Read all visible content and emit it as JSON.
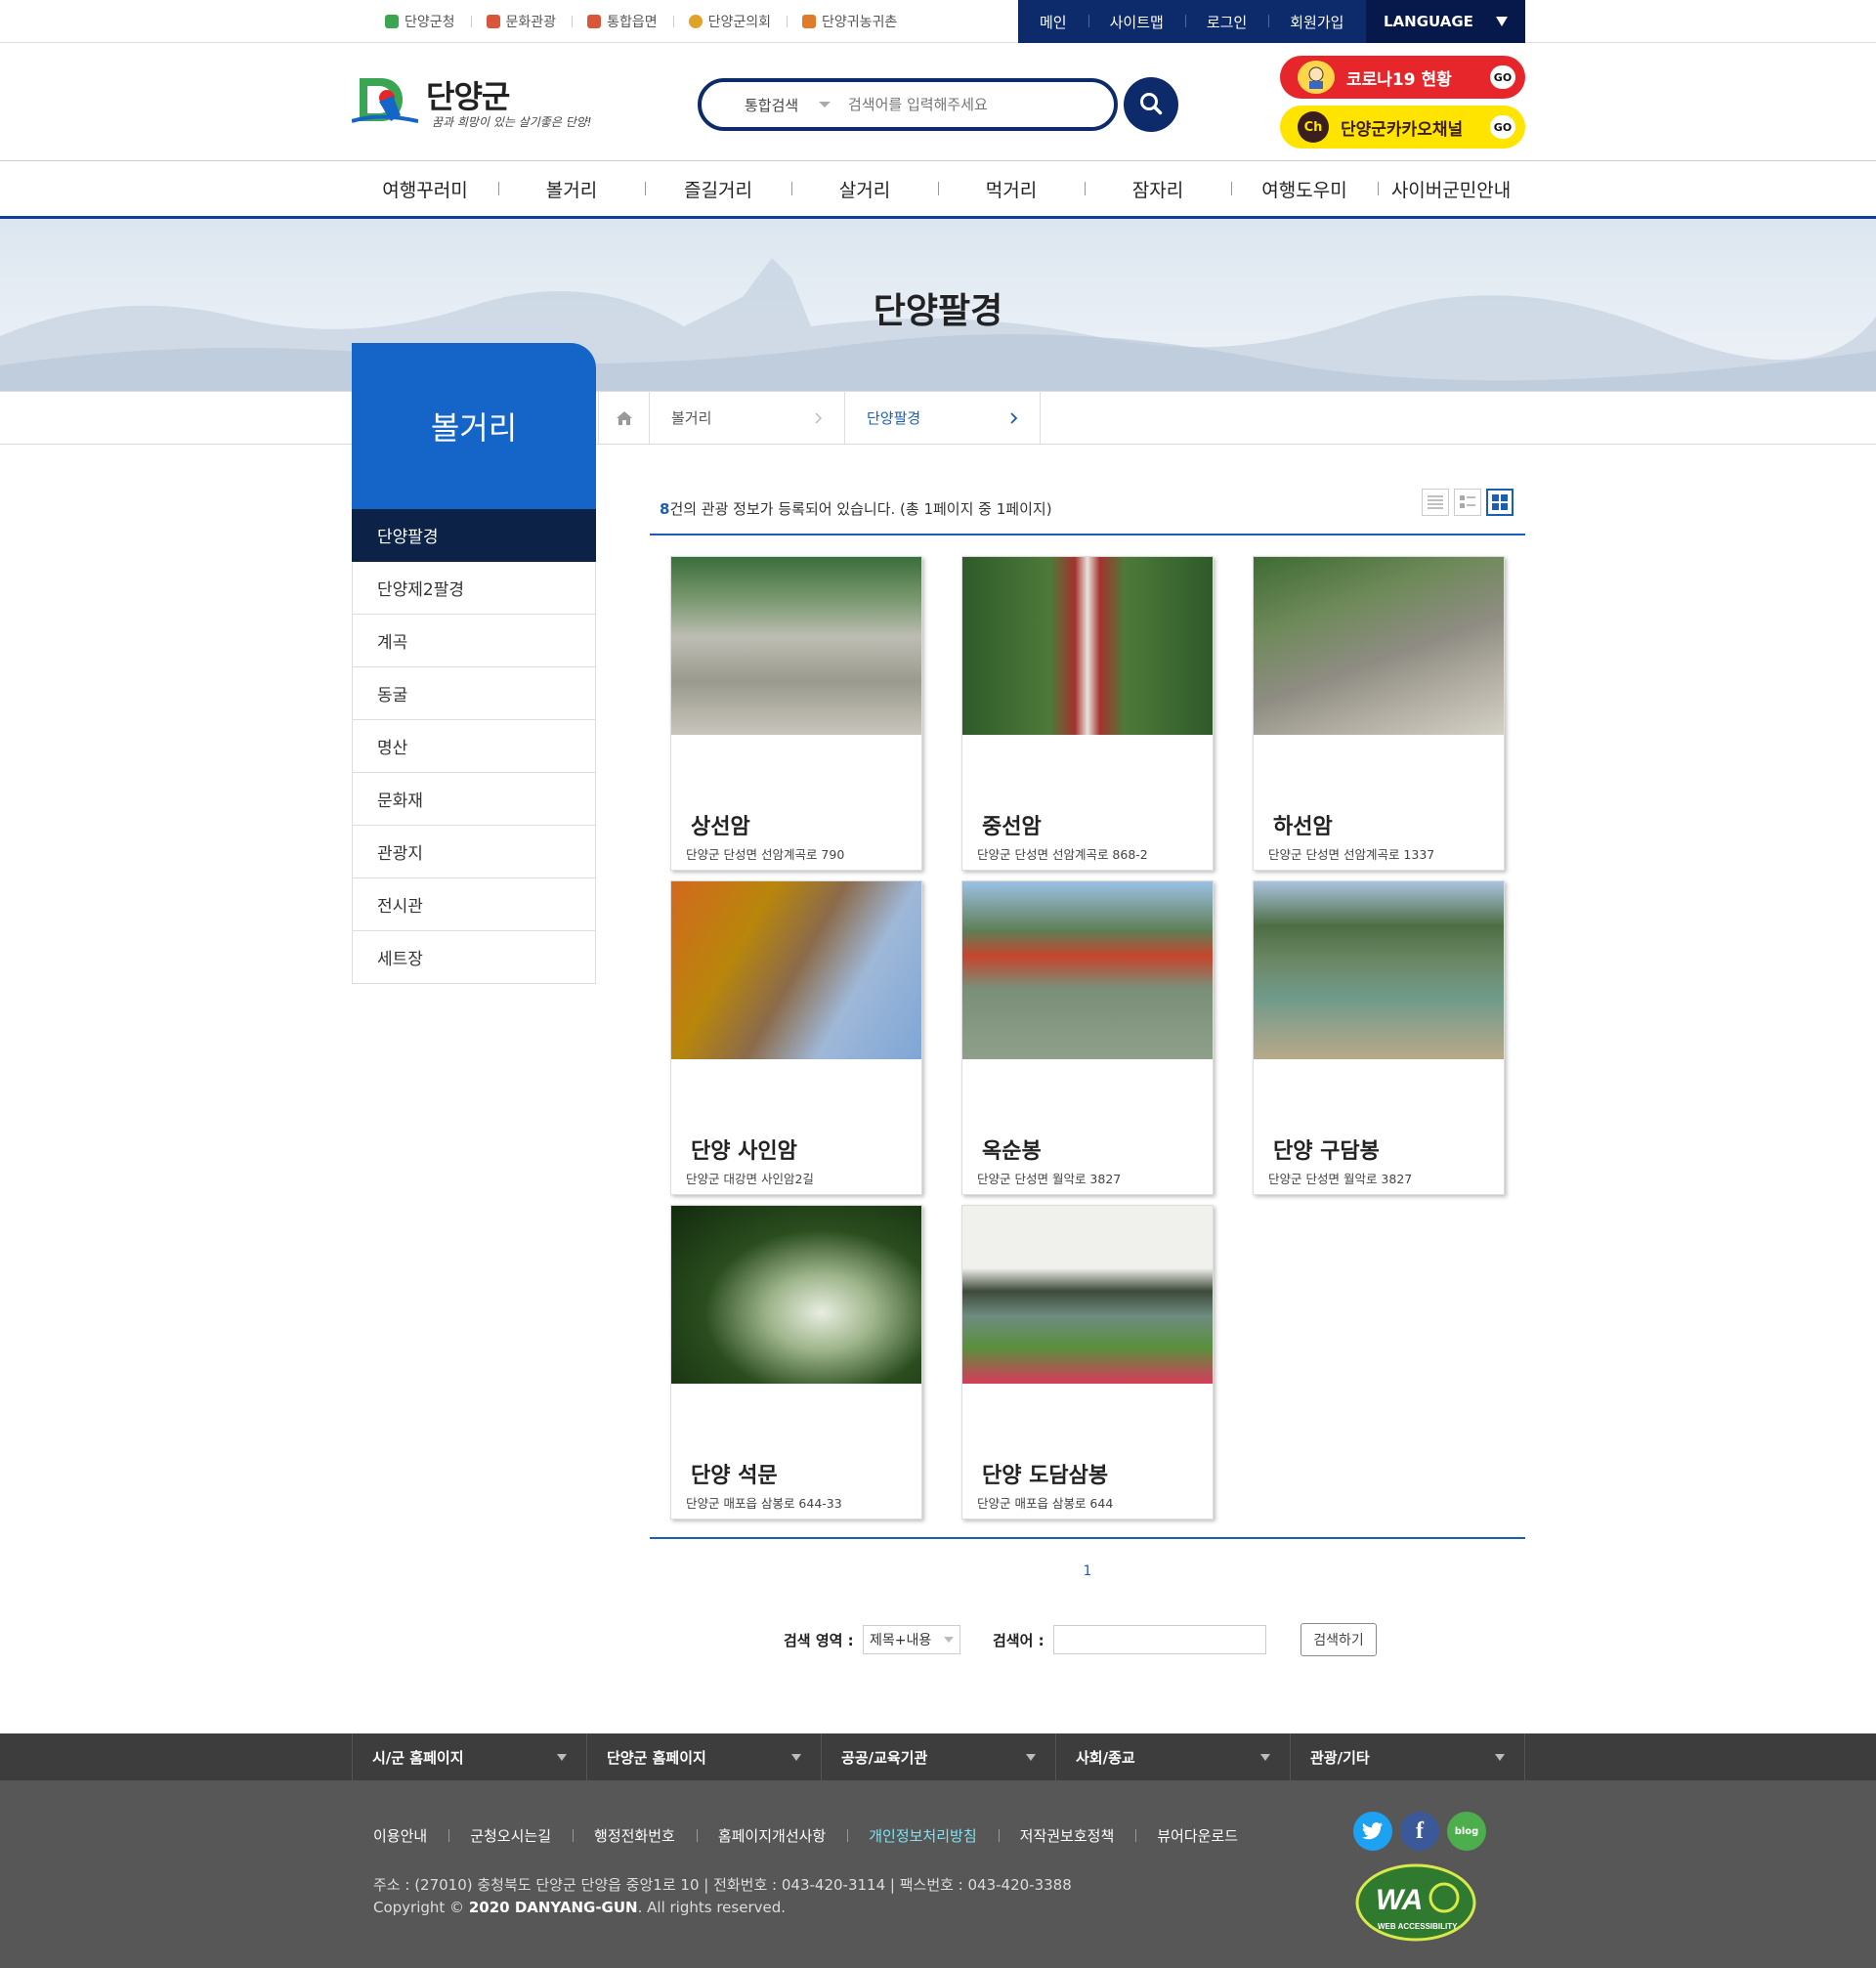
{
  "top_links": [
    {
      "label": "단양군청",
      "icon": "danyang-gov-icon",
      "color": "#3aa653"
    },
    {
      "label": "문화관광",
      "icon": "camera-icon",
      "color": "#d9563b"
    },
    {
      "label": "통합읍면",
      "icon": "signpost-icon",
      "color": "#d9563b"
    },
    {
      "label": "단양군의회",
      "icon": "council-icon",
      "color": "#e0a32a"
    },
    {
      "label": "단양귀농귀촌",
      "icon": "house-icon",
      "color": "#e07b2a"
    }
  ],
  "utility": {
    "main": "메인",
    "sitemap": "사이트맵",
    "login": "로그인",
    "join": "회원가입",
    "language": "LANGUAGE"
  },
  "logo": {
    "title": "단양군",
    "subtitle": "꿈과 희망이 있는 살기좋은 단양!"
  },
  "search": {
    "category": "통합검색",
    "placeholder": "검색어를 입력해주세요"
  },
  "banners": {
    "covid": "코로나19 현황",
    "kakao": "단양군카카오채널",
    "go": "GO",
    "kakao_badge": "Ch"
  },
  "gnb": [
    "여행꾸러미",
    "볼거리",
    "즐길거리",
    "살거리",
    "먹거리",
    "잠자리",
    "여행도우미",
    "사이버군민안내"
  ],
  "page_title": "단양팔경",
  "breadcrumb": [
    "볼거리",
    "단양팔경"
  ],
  "side": {
    "title": "볼거리",
    "items": [
      "단양팔경",
      "단양제2팔경",
      "계곡",
      "동굴",
      "명산",
      "문화재",
      "관광지",
      "전시관",
      "세트장"
    ],
    "active": 0
  },
  "list_info": {
    "count": "8",
    "text": "건의 관광 정보가 등록되어 있습니다. (총 1페이지 중 1페이지)"
  },
  "cards": [
    {
      "name": "상선암",
      "address": "단양군 단성면 선암계곡로 790"
    },
    {
      "name": "중선암",
      "address": "단양군 단성면 선암계곡로 868-2"
    },
    {
      "name": "하선암",
      "address": "단양군 단성면 선암계곡로 1337"
    },
    {
      "name": "단양 사인암",
      "address": "단양군 대강면 사인암2길"
    },
    {
      "name": "옥순봉",
      "address": "단양군 단성면 월악로 3827"
    },
    {
      "name": "단양 구담봉",
      "address": "단양군 단성면 월악로 3827"
    },
    {
      "name": "단양 석문",
      "address": "단양군 매포읍 삼봉로 644-33"
    },
    {
      "name": "단양 도담삼봉",
      "address": "단양군 매포읍 삼봉로 644"
    }
  ],
  "pager": {
    "current": "1"
  },
  "bottom_search": {
    "area_label": "검색 영역 :",
    "area_value": "제목+내용",
    "keyword_label": "검색어 :",
    "button": "검색하기"
  },
  "footer_nav": [
    "시/군 홈페이지",
    "단양군 홈페이지",
    "공공/교육기관",
    "사회/종교",
    "관광/기타"
  ],
  "footer_links": [
    "이용안내",
    "군청오시는길",
    "행정전화번호",
    "홈페이지개선사항",
    "개인정보처리방침",
    "저작권보호정책",
    "뷰어다운로드"
  ],
  "footer_highlight": 4,
  "address": "주소 : (27010) 충청북도 단양군 단양읍 중앙1로 10 | 전화번호 : 043-420-3114 | 팩스번호 : 043-420-3388",
  "copyright": {
    "pre": "Copyright ©",
    "owner": "2020 DANYANG-GUN",
    "post": ". All rights reserved."
  },
  "sns": [
    "twitter-icon",
    "facebook-icon",
    "blog-icon"
  ],
  "sns_blog_label": "blog",
  "wa_mark": {
    "text": "WA",
    "caption": "WEB ACCESSIBILITY"
  },
  "colors": {
    "navy": "#0d2b6b",
    "accent_blue": "#1565c8",
    "active_side": "#0c2247",
    "covid_red": "#e6262a",
    "kakao_yellow": "#ffe400"
  }
}
